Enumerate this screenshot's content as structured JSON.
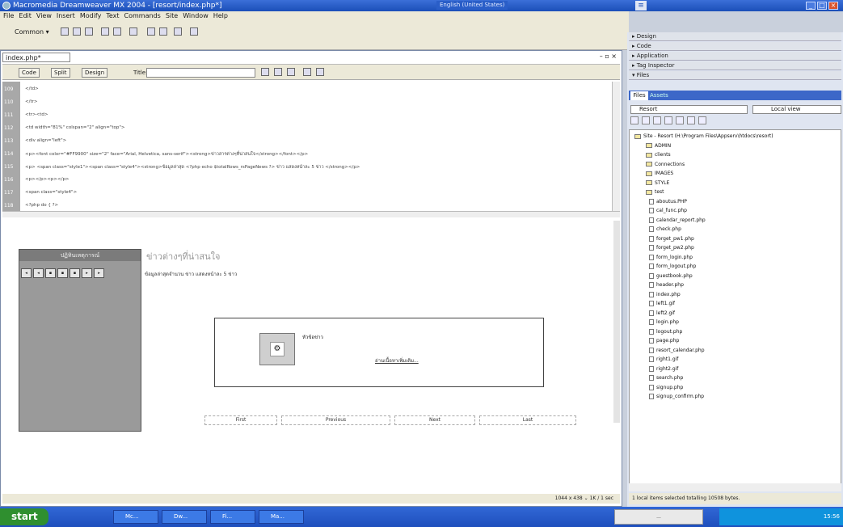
{
  "window": {
    "title": "Macromedia Dreamweaver MX 2004 - [resort/index.php*]",
    "language": "English (United States)"
  },
  "menu": [
    "File",
    "Edit",
    "View",
    "Insert",
    "Modify",
    "Text",
    "Commands",
    "Site",
    "Window",
    "Help"
  ],
  "insert_bar": {
    "category": "Common ▾"
  },
  "document": {
    "tab": "index.php*",
    "view_buttons": {
      "code": "Code",
      "split": "Split",
      "design": "Design"
    },
    "title_label": "Title:",
    "title_value": "",
    "status": "1044 x 438 ⌄ 1K / 1 sec"
  },
  "code_lines": [
    {
      "n": "109",
      "t": "</td>"
    },
    {
      "n": "110",
      "t": "</tr>"
    },
    {
      "n": "111",
      "t": "<tr><td>"
    },
    {
      "n": "112",
      "t": "<td width=\"81%\" colspan=\"2\" align=\"top\">"
    },
    {
      "n": "113",
      "t": "<div align=\"left\">"
    },
    {
      "n": "114",
      "t": "<p><font color=\"#FF9900\" size=\"2\" face=\"Arial, Helvetica, sans-serif\"><strong>ข่าวสารต่างๆที่น่าสนใจ</strong></font></p>"
    },
    {
      "n": "115",
      "t": "<p>        <span class=\"style1\"><span class=\"style4\"><strong>ข้อมูลล่าสุด <?php echo $totalRows_rsPageNews ?> ข่าว แสดงหน้าละ 5 ข่าว </strong></p>"
    },
    {
      "n": "116",
      "t": "<p></p><p></p>"
    },
    {
      "n": "117",
      "t": "<span class=\"style4\">"
    },
    {
      "n": "118",
      "t": "<?php do { ?>"
    }
  ],
  "design": {
    "left_header": "ปฏิทินเหตุการณ์",
    "heading": "ข่าวต่างๆที่น่าสนใจ",
    "subtext": "ข้อมูลล่าสุดจำนวน ข่าว แสดงหน้าละ 5 ข่าว",
    "topic_label": "หัวข้อข่าว",
    "read_more": "อ่านเนื้อหาเพิ่มเติม...",
    "pager": [
      "First",
      "Previous",
      "Next",
      "Last"
    ]
  },
  "panels": {
    "groups": [
      "Design",
      "Code",
      "Application",
      "Tag Inspector",
      "Files"
    ],
    "files_tabs": [
      "Files",
      "Assets"
    ],
    "site": "Resort",
    "view": "Local view",
    "root": "Site - Resort (H:\\Program Files\\Appserv\\htdocs\\resort)",
    "folders": [
      "ADMIN",
      "clients",
      "Connections",
      "IMAGES",
      "STYLE",
      "test"
    ],
    "files": [
      "aboutus.PHP",
      "cal_func.php",
      "calendar_report.php",
      "check.php",
      "forget_pw1.php",
      "forget_pw2.php",
      "form_login.php",
      "form_logout.php",
      "guestbook.php",
      "header.php",
      "index.php",
      "left1.gif",
      "left2.gif",
      "login.php",
      "logout.php",
      "page.php",
      "resort_calendar.php",
      "right1.gif",
      "right2.gif",
      "search.php",
      "signup.php",
      "signup_confirm.php"
    ],
    "status": "1 local items selected totalling 10508 bytes."
  },
  "taskbar": {
    "start": "start",
    "items": [
      "Mc...",
      "Dw...",
      "Fi...",
      "Ma..."
    ],
    "clock": "15:56"
  }
}
